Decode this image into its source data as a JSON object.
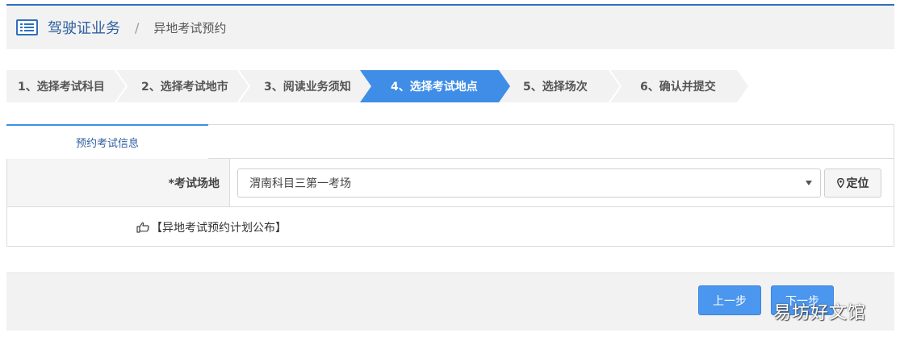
{
  "breadcrumb": {
    "main": "驾驶证业务",
    "separator": "/",
    "current": "异地考试预约"
  },
  "steps": [
    {
      "label": "1、选择考试科目",
      "active": false
    },
    {
      "label": "2、选择考试地市",
      "active": false
    },
    {
      "label": "3、阅读业务须知",
      "active": false
    },
    {
      "label": "4、选择考试地点",
      "active": true
    },
    {
      "label": "5、选择场次",
      "active": false
    },
    {
      "label": "6、确认并提交",
      "active": false
    }
  ],
  "form": {
    "tab_label": "预约考试信息",
    "venue_label": "*考试场地",
    "venue_value": "渭南科目三第一考场",
    "locate_label": "定位",
    "notice_link": "【异地考试预约计划公布】"
  },
  "footer": {
    "prev_label": "上一步",
    "next_label": "下一步"
  },
  "watermark": "易坊好文馆",
  "colors": {
    "accent": "#3f8de6",
    "brand": "#2f5f9f",
    "button": "#4b96ee"
  }
}
